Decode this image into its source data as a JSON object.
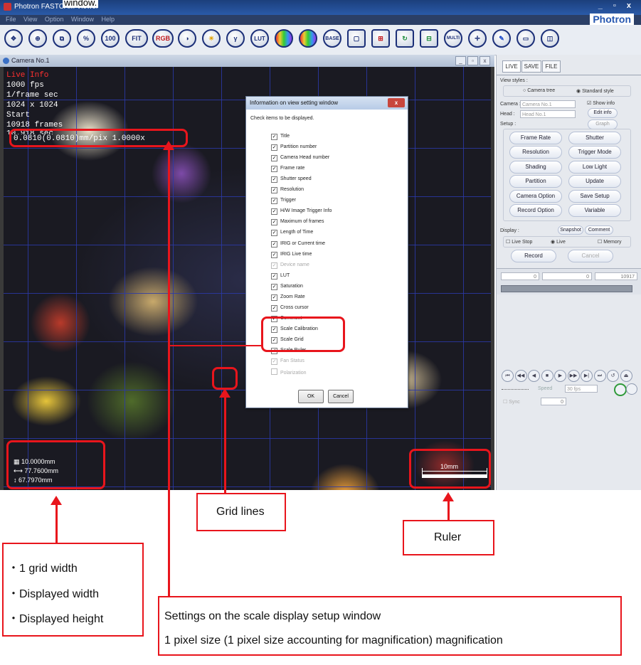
{
  "window": {
    "app_title": "Photron FASTCAM Viewer",
    "window_buttons": "_ ▫ x",
    "brand": "Photron",
    "stray_text": "window."
  },
  "menu": [
    "File",
    "View",
    "Option",
    "Window",
    "Help"
  ],
  "toolbar": {
    "buttons": [
      "move-icon",
      "zoom-in-icon",
      "crop-icon",
      "percent",
      "100%",
      "FIT",
      "RGB",
      "contrast-icon",
      "brightness-icon",
      "Gamma",
      "LUT RESET",
      "color-bar-icon",
      "color-reset-icon",
      "BASE",
      "frame-icon",
      "split-icon",
      "refresh-icon",
      "pip-icon",
      "MULTI LOCK",
      "cross-cursor-icon",
      "pen-icon",
      "ruler-icon",
      "eraser-icon"
    ],
    "labels": {
      "percent": "%",
      "hundred": "100",
      "fit": "FIT",
      "rgb": "RGB",
      "gamma": "γ",
      "lut": "LUT",
      "multi": "MULTI"
    }
  },
  "camera": {
    "title": "Camera No.1",
    "buttons": [
      "_",
      "▫",
      "x"
    ]
  },
  "overlay": {
    "live_info": "Live Info",
    "fps": "1000 fps",
    "shutter": "1/frame sec",
    "resolution": "1024 x 1024",
    "trigger": "Start",
    "frames": "10918 frames",
    "time": "10.918 sec",
    "calibration": "0.0810(0.0810)mm/pix  1.0000x",
    "grid_width": "10.0000mm",
    "disp_width": "77.7600mm",
    "disp_height": "67.7970mm",
    "ruler_label": "10mm"
  },
  "dialog": {
    "title": "Information on view setting window",
    "close": "x",
    "instruction": "Check items to be displayed.",
    "items": [
      {
        "label": "Title",
        "checked": true,
        "enabled": true
      },
      {
        "label": "Partition number",
        "checked": true,
        "enabled": true
      },
      {
        "label": "Camera Head number",
        "checked": true,
        "enabled": true
      },
      {
        "label": "Frame rate",
        "checked": true,
        "enabled": true
      },
      {
        "label": "Shutter speed",
        "checked": true,
        "enabled": true
      },
      {
        "label": "Resolution",
        "checked": true,
        "enabled": true
      },
      {
        "label": "Trigger",
        "checked": true,
        "enabled": true
      },
      {
        "label": "H/W Image Trigger Info",
        "checked": true,
        "enabled": true
      },
      {
        "label": "Maximum of frames",
        "checked": true,
        "enabled": true
      },
      {
        "label": "Length of Time",
        "checked": true,
        "enabled": true
      },
      {
        "label": "IRIG or Current time",
        "checked": true,
        "enabled": true
      },
      {
        "label": "IRIG Live time",
        "checked": true,
        "enabled": true
      },
      {
        "label": "Device name",
        "checked": true,
        "enabled": false
      },
      {
        "label": "LUT",
        "checked": true,
        "enabled": true
      },
      {
        "label": "Saturation",
        "checked": true,
        "enabled": true
      },
      {
        "label": "Zoom Rate",
        "checked": true,
        "enabled": true
      },
      {
        "label": "Cross cursor",
        "checked": true,
        "enabled": true
      },
      {
        "label": "Comment",
        "checked": true,
        "enabled": true
      },
      {
        "label": "Scale Calibration",
        "checked": true,
        "enabled": true
      },
      {
        "label": "Scale Grid",
        "checked": true,
        "enabled": true
      },
      {
        "label": "Scale Ruler",
        "checked": true,
        "enabled": true
      },
      {
        "label": "Fan Status",
        "checked": true,
        "enabled": false
      },
      {
        "label": "Polarization",
        "checked": false,
        "enabled": false
      }
    ],
    "ok": "OK",
    "cancel": "Cancel"
  },
  "panel": {
    "tabs": [
      "LIVE",
      "SAVE",
      "FILE"
    ],
    "view_styles": "View styles :",
    "camera_tree": "Camera tree",
    "standard_style": "Standard style",
    "camera_label": "Camera :",
    "camera_value": "Camera No.1",
    "head_label": "Head :",
    "head_value": "Head No.1",
    "show_info": "Show info",
    "edit_info": "Edit info",
    "setup_label": "Setup :",
    "graph": "Graph",
    "setup_buttons": [
      "Frame Rate",
      "Shutter",
      "Resolution",
      "Trigger Mode",
      "Shading",
      "Low Light",
      "Partition",
      "Update",
      "Camera Option",
      "Save Setup",
      "Record Option",
      "Variable"
    ],
    "display_label": "Display :",
    "snapshot": "Snapshot",
    "comment": "Comment",
    "live_stop": "Live Stop",
    "live": "Live",
    "memory": "Memory",
    "record": "Record",
    "cancel": "Cancel",
    "slider_left": "0",
    "slider_mid": "0",
    "slider_right": "10917",
    "speed_label": "Speed",
    "speed_value": "30 fps",
    "loop_label": "Sync",
    "frame_value": "0"
  },
  "annotations": {
    "grid_lines": "Grid lines",
    "ruler": "Ruler",
    "left_callout": [
      "・1 grid width",
      "・Displayed width",
      "・Displayed height"
    ],
    "bottom_callout": [
      "Settings on the scale display setup window",
      "1 pixel size (1 pixel size accounting for magnification) magnification"
    ]
  },
  "colors": {
    "annotation_red": "#e8151c",
    "grid_blue": "#2c3aa8",
    "title_blue": "#1c3f7c",
    "brand_blue": "#2456b0"
  }
}
